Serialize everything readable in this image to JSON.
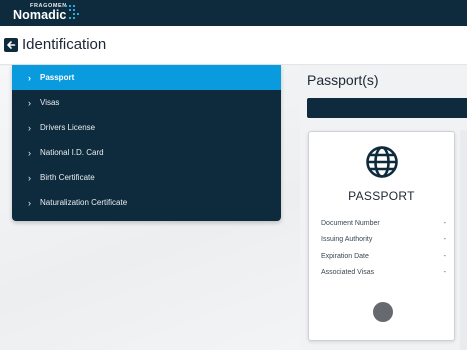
{
  "brand": {
    "company": "FRAGOMEN",
    "product": "Nomadic"
  },
  "header": {
    "title": "Identification"
  },
  "sidebar": {
    "items": [
      {
        "label": "Passport",
        "active": true
      },
      {
        "label": "Visas",
        "active": false
      },
      {
        "label": "Drivers License",
        "active": false
      },
      {
        "label": "National I.D. Card",
        "active": false
      },
      {
        "label": "Birth Certificate",
        "active": false
      },
      {
        "label": "Naturalization Certificate",
        "active": false
      }
    ]
  },
  "main": {
    "section_title": "Passport(s)",
    "card": {
      "title": "PASSPORT",
      "icon": "globe-icon",
      "fields": [
        {
          "label": "Document Number",
          "value": "-"
        },
        {
          "label": "Issuing Authority",
          "value": "-"
        },
        {
          "label": "Expiration Date",
          "value": "-"
        },
        {
          "label": "Associated Visas",
          "value": "-"
        }
      ]
    }
  },
  "colors": {
    "navy": "#0e2a3d",
    "accent": "#0a9bde"
  }
}
